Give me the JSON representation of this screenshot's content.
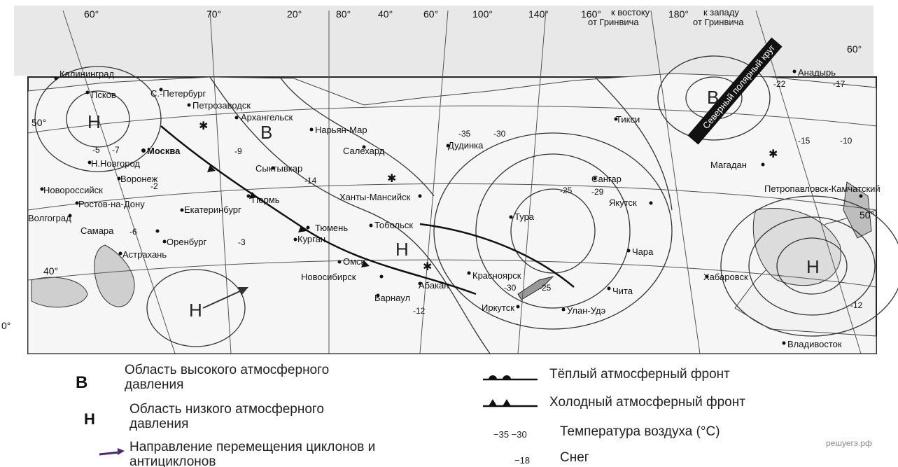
{
  "map": {
    "top_degree_labels": [
      "60°",
      "70°",
      "20°",
      "80°",
      "40°",
      "60°",
      "100°",
      "140°",
      "160°",
      "180°"
    ],
    "east_note": [
      "к востоку",
      "от Гринвича"
    ],
    "west_note": [
      "к западу",
      "от Гринвича"
    ],
    "side_degree_labels": [
      "60°",
      "50°",
      "40°",
      "50°",
      "0°"
    ],
    "arctic_circle_label": "Северный полярный круг",
    "cities": [
      "Калининград",
      "Псков",
      "С.-Петербург",
      "Петрозаводск",
      "Архангельск",
      "Москва",
      "Н.Новгород",
      "Воронеж",
      "Новороссийск",
      "Ростов-на-Дону",
      "Волгоград",
      "Астрахань",
      "Оренбург",
      "Екатеринбург",
      "Пермь",
      "Сыктывкар",
      "Нарьян-Мар",
      "Салехард",
      "Ханты-Мансийск",
      "Тюмень",
      "Тобольск",
      "Курган",
      "Омск",
      "Новосибирск",
      "Барнаул",
      "Абакан",
      "Красноярск",
      "Иркутск",
      "Улан-Удэ",
      "Чита",
      "Дудинка",
      "Тикси",
      "Якутск",
      "Тура",
      "Сангар",
      "Магадан",
      "Анадырь",
      "Петропавловск-Камчатский",
      "Хабаровск",
      "Чара",
      "Владивосток",
      "Самара"
    ],
    "pressure_centers": [
      "В",
      "В",
      "Н",
      "Н",
      "Н",
      "Н"
    ],
    "temperatures": [
      "-5",
      "-7",
      "-9",
      "-14",
      "-35",
      "-30",
      "-29",
      "-25",
      "-30",
      "-25",
      "-12",
      "-15",
      "-10",
      "-12",
      "-17",
      "-22",
      "-2",
      "-6",
      "-3"
    ]
  },
  "legend": {
    "high_symbol": "В",
    "high_text": "Область высокого атмосферного давления",
    "low_symbol": "Н",
    "low_text": "Область низкого атмосферного давления",
    "direction_text": "Направление перемещения циклонов и антициклонов",
    "warm_front_text": "Тёплый атмосферный фронт",
    "cold_front_text": "Холодный атмосферный фронт",
    "temp_sample": "−35 −30",
    "temp_text": "Температура воздуха (°С)",
    "snow_sample": "−18",
    "snow_text": "Снег"
  },
  "watermark": "решуегэ.рф"
}
